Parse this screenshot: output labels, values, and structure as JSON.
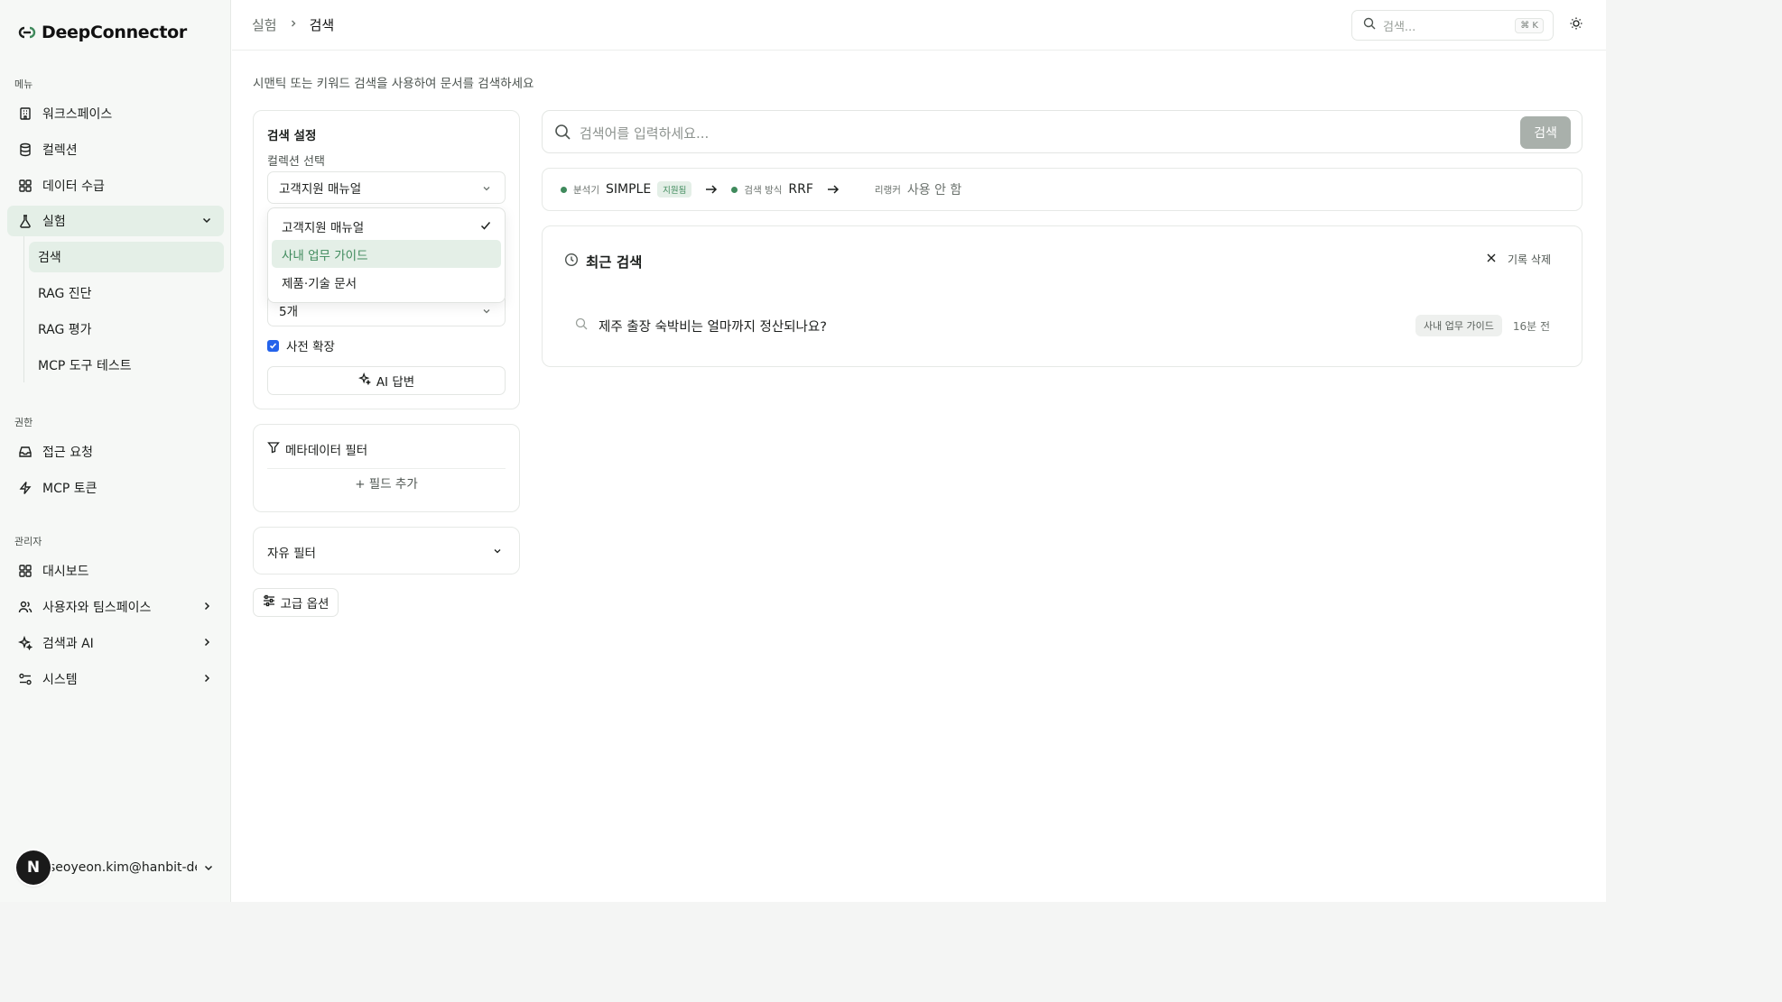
{
  "brand": {
    "name": "DeepConnector"
  },
  "sidebar": {
    "menu_label": "메뉴",
    "menu_items": [
      {
        "label": "워크스페이스",
        "icon": "building-icon"
      },
      {
        "label": "컬렉션",
        "icon": "database-icon"
      },
      {
        "label": "데이터 수급",
        "icon": "grid-icon"
      },
      {
        "label": "실험",
        "icon": "flask-icon"
      }
    ],
    "sub_items": [
      {
        "label": "검색"
      },
      {
        "label": "RAG 진단"
      },
      {
        "label": "RAG 평가"
      },
      {
        "label": "MCP 도구 테스트"
      }
    ],
    "perm_label": "권한",
    "perm_items": [
      {
        "label": "접근 요청",
        "icon": "inbox-icon"
      },
      {
        "label": "MCP 토큰",
        "icon": "zap-icon"
      }
    ],
    "admin_label": "관리자",
    "admin_items": [
      {
        "label": "대시보드",
        "icon": "grid-icon"
      },
      {
        "label": "사용자와 팀스페이스",
        "icon": "users-icon"
      },
      {
        "label": "검색과 AI",
        "icon": "sparkles-icon"
      },
      {
        "label": "시스템",
        "icon": "settings-sliders-icon"
      }
    ],
    "user": {
      "avatar_letter": "N",
      "email": "seoyeon.kim@hanbit-de..."
    }
  },
  "header": {
    "breadcrumb": [
      "실험",
      "검색"
    ],
    "search_placeholder": "검색...",
    "shortcut": "⌘ K"
  },
  "page": {
    "description": "시맨틱 또는 키워드 검색을 사용하여 문서를 검색하세요"
  },
  "settings": {
    "title": "검색 설정",
    "collection_label": "컬렉션 선택",
    "collection_value": "고객지원 매뉴얼",
    "dropdown_options": [
      "고객지원 매뉴얼",
      "사내 업무 가이드",
      "제품·기술 문서"
    ],
    "selected_option": "고객지원 매뉴얼",
    "hovered_option": "사내 업무 가이드",
    "topk_value": "5개",
    "expand_label": "사전 확장",
    "expand_checked": true,
    "ai_answer_label": "AI 답변"
  },
  "metadata_filter": {
    "title": "메타데이터 필터",
    "add_field_label": "+ 필드 추가"
  },
  "free_filter": {
    "title": "자유 필터"
  },
  "advanced": {
    "label": "고급 옵션"
  },
  "search": {
    "placeholder": "검색어를 입력하세요...",
    "button_label": "검색"
  },
  "pipeline": {
    "analyzer_label": "분석기",
    "analyzer_value": "SIMPLE",
    "analyzer_badge": "지원됨",
    "method_label": "검색 방식",
    "method_value": "RRF",
    "reranker_label": "리랭커",
    "reranker_value": "사용 안 함"
  },
  "recent": {
    "title": "최근 검색",
    "clear_label": "기록 삭제",
    "items": [
      {
        "query": "제주 출장 숙박비는 얼마까지 정산되나요?",
        "tag": "사내 업무 가이드",
        "time": "16분 전"
      }
    ]
  },
  "colors": {
    "accent": "#3f8a5c",
    "accent_bg": "#e4efe7",
    "checkbox": "#2463eb"
  }
}
